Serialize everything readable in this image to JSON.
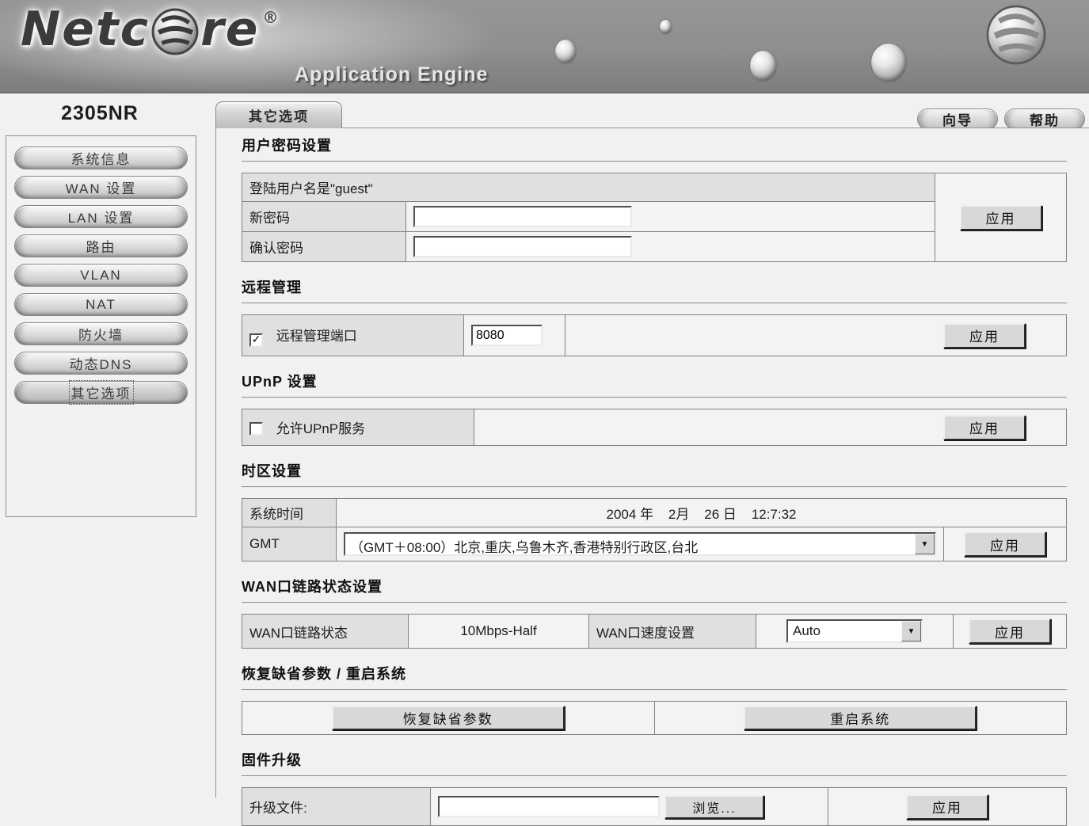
{
  "colors": {
    "header_bg": "#8e8e8e",
    "page_bg": "#f1f1f1",
    "label_cell_bg": "#e0e0e0",
    "button_face": "#d8d8d8",
    "table_border": "#828282"
  },
  "header": {
    "brand_prefix": "Netc",
    "brand_suffix": "re",
    "registered_mark": "®",
    "tagline": "Application Engine"
  },
  "sidebar": {
    "model": "2305NR",
    "items": [
      {
        "label": "系统信息",
        "active": false
      },
      {
        "label": "WAN 设置",
        "active": false
      },
      {
        "label": "LAN 设置",
        "active": false
      },
      {
        "label": "路由",
        "active": false
      },
      {
        "label": "VLAN",
        "active": false
      },
      {
        "label": "NAT",
        "active": false
      },
      {
        "label": "防火墙",
        "active": false
      },
      {
        "label": "动态DNS",
        "active": false
      },
      {
        "label": "其它选项",
        "active": true
      }
    ]
  },
  "topbar": {
    "wizard": "向导",
    "help": "帮助"
  },
  "tab": {
    "label": "其它选项"
  },
  "common": {
    "apply": "应用"
  },
  "password_section": {
    "title": "用户密码设置",
    "login_note": "登陆用户名是\"guest\"",
    "new_password_label": "新密码",
    "confirm_password_label": "确认密码"
  },
  "remote_section": {
    "title": "远程管理",
    "checkbox_label": "远程管理端口",
    "checkbox_checked": true,
    "port_value": "8080"
  },
  "upnp_section": {
    "title": "UPnP 设置",
    "checkbox_label": "允许UPnP服务",
    "checkbox_checked": false
  },
  "timezone_section": {
    "title": "时区设置",
    "system_time_label": "系统时间",
    "system_time_value": "2004 年    2月    26 日    12:7:32",
    "gmt_label": "GMT",
    "gmt_selected": "（GMT＋08:00）北京,重庆,乌鲁木齐,香港特别行政区,台北"
  },
  "wan_section": {
    "title": "WAN口链路状态设置",
    "link_status_label": "WAN口链路状态",
    "link_status_value": "10Mbps-Half",
    "speed_label": "WAN口速度设置",
    "speed_selected": "Auto"
  },
  "reset_section": {
    "title": "恢复缺省参数 / 重启系统",
    "restore_button": "恢复缺省参数",
    "reboot_button": "重启系统"
  },
  "firmware_section": {
    "title": "固件升级",
    "file_label": "升级文件:",
    "browse_button": "浏览..."
  }
}
